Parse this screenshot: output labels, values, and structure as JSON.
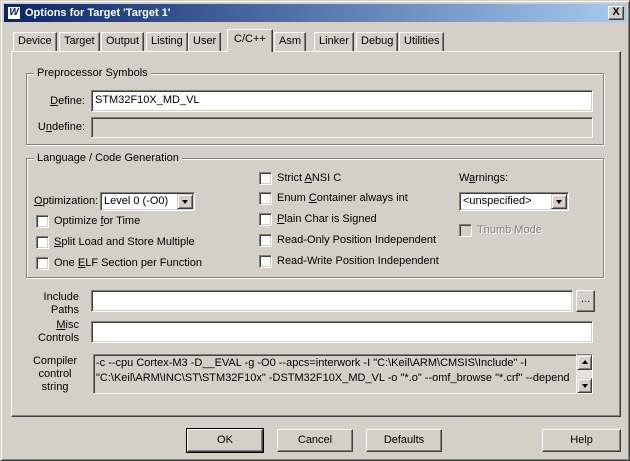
{
  "window": {
    "title": "Options for Target 'Target 1'",
    "close_glyph": "X",
    "app_icon_glyph": "W"
  },
  "tabs": [
    {
      "label": "Device"
    },
    {
      "label": "Target"
    },
    {
      "label": "Output"
    },
    {
      "label": "Listing"
    },
    {
      "label": "User"
    },
    {
      "label": "C/C++",
      "active": true
    },
    {
      "label": "Asm"
    },
    {
      "label": "Linker"
    },
    {
      "label": "Debug"
    },
    {
      "label": "Utilities"
    }
  ],
  "preprocessor": {
    "group_title": "Preprocessor Symbols",
    "define_label_u": "D",
    "define_label_rest": "efine:",
    "define_value": "STM32F10X_MD_VL",
    "undefine_label_pre": "U",
    "undefine_label_u": "n",
    "undefine_label_rest": "define:",
    "undefine_value": ""
  },
  "language": {
    "group_title": "Language / Code Generation",
    "optimization_label_u": "O",
    "optimization_label_rest": "ptimization:",
    "optimization_value": "Level 0 (-O0)",
    "checkboxes_left": [
      {
        "pre": "Optimize ",
        "u": "f",
        "post": "or Time",
        "checked": false
      },
      {
        "pre": "",
        "u": "S",
        "post": "plit Load and Store Multiple",
        "checked": false
      },
      {
        "pre": "One ",
        "u": "E",
        "post": "LF Section per Function",
        "checked": false
      }
    ],
    "checkboxes_mid": [
      {
        "pre": "Strict ",
        "u": "A",
        "post": "NSI C",
        "checked": false
      },
      {
        "pre": "Enum ",
        "u": "C",
        "post": "ontainer always int",
        "checked": false
      },
      {
        "pre": "",
        "u": "P",
        "post": "lain Char is Signed",
        "checked": false
      },
      {
        "pre": "Read-Only Position Independent",
        "u": "",
        "post": "",
        "checked": false
      },
      {
        "pre": "Read-Write Position Independent",
        "u": "",
        "post": "",
        "checked": false
      }
    ],
    "warnings_label_pre": "W",
    "warnings_label_u": "a",
    "warnings_label_rest": "rnings:",
    "warnings_value": "<unspecified>",
    "thumb_mode_label": "Thumb Mode",
    "thumb_mode_checked": false,
    "thumb_mode_enabled": false
  },
  "paths": {
    "include_label_line1": "Include",
    "include_label_line2": "Paths",
    "include_value": "",
    "browse_label": "...",
    "misc_label_line1_u": "M",
    "misc_label_line1_rest": "isc",
    "misc_label_line2": "Controls",
    "misc_value": ""
  },
  "compiler": {
    "label_line1": "Compiler",
    "label_line2": "control",
    "label_line3": "string",
    "line1": "-c --cpu Cortex-M3 -D__EVAL -g -O0 --apcs=interwork -I \"C:\\Keil\\ARM\\CMSIS\\Include\" -I",
    "line2": "\"C:\\Keil\\ARM\\INC\\ST\\STM32F10x\" -DSTM32F10X_MD_VL -o \"*.o\" --omf_browse \"*.crf\" --depend"
  },
  "buttons": {
    "ok": "OK",
    "cancel": "Cancel",
    "defaults": "Defaults",
    "help": "Help"
  }
}
